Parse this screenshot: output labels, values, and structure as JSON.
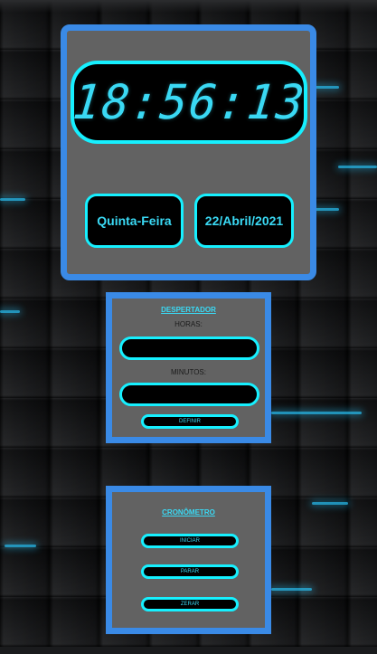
{
  "clock": {
    "time": "18:56:13",
    "weekday": "Quinta-Feira",
    "date": "22/Abril/2021"
  },
  "alarm": {
    "title": "DESPERTADOR",
    "hours_label": "HORAS:",
    "hours_value": "",
    "minutes_label": "MINUTOS:",
    "minutes_value": "",
    "set_label": "DEFINIR"
  },
  "stopwatch": {
    "title": "CRONÔMETRO",
    "start_label": "INICIAR",
    "stop_label": "PARAR",
    "reset_label": "ZERAR"
  },
  "colors": {
    "panel_bg": "#626262",
    "panel_border": "#3a8ae6",
    "neon": "#16f0ff",
    "text_accent": "#3ad9f4",
    "display_bg": "#000000"
  }
}
